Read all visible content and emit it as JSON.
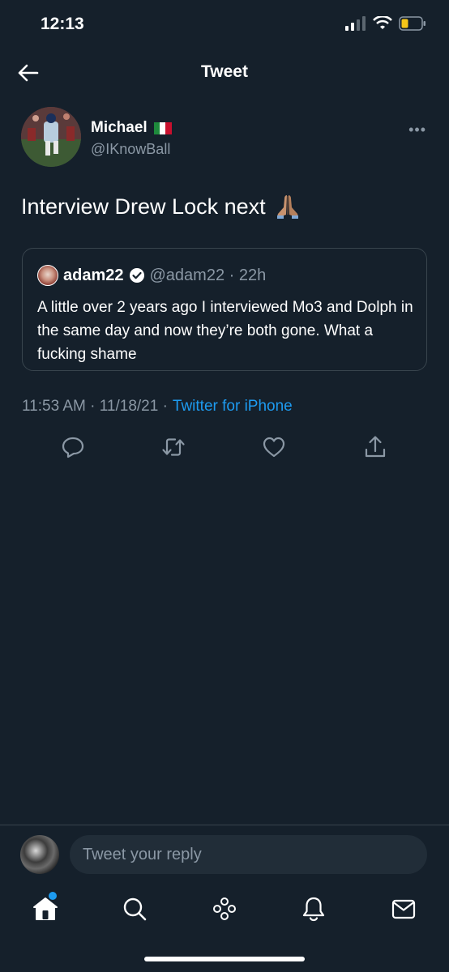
{
  "status_bar": {
    "time": "12:13"
  },
  "nav": {
    "title": "Tweet"
  },
  "tweet": {
    "author_name": "Michael",
    "author_handle": "@IKnowBall",
    "text": "Interview Drew Lock next",
    "timestamp": "11:53 AM · 11/18/21 ·",
    "source": "Twitter for iPhone"
  },
  "quote": {
    "name": "adam22",
    "handle": "@adam22 · 22h",
    "text": "A little over 2 years ago I interviewed Mo3 and Dolph in the same day and now they’re both gone. What a fucking shame"
  },
  "reply": {
    "placeholder": "Tweet your reply"
  },
  "icons": {
    "back": "back-arrow-icon",
    "more": "more-icon",
    "reply": "reply-icon",
    "retweet": "retweet-icon",
    "like": "like-icon",
    "share": "share-icon",
    "home": "home-icon",
    "search": "search-icon",
    "spaces": "spaces-icon",
    "notifications": "notifications-icon",
    "messages": "messages-icon"
  },
  "colors": {
    "background": "#15202b",
    "accent": "#1d9bf0",
    "secondary_text": "#8b98a5",
    "border": "#38444d"
  }
}
